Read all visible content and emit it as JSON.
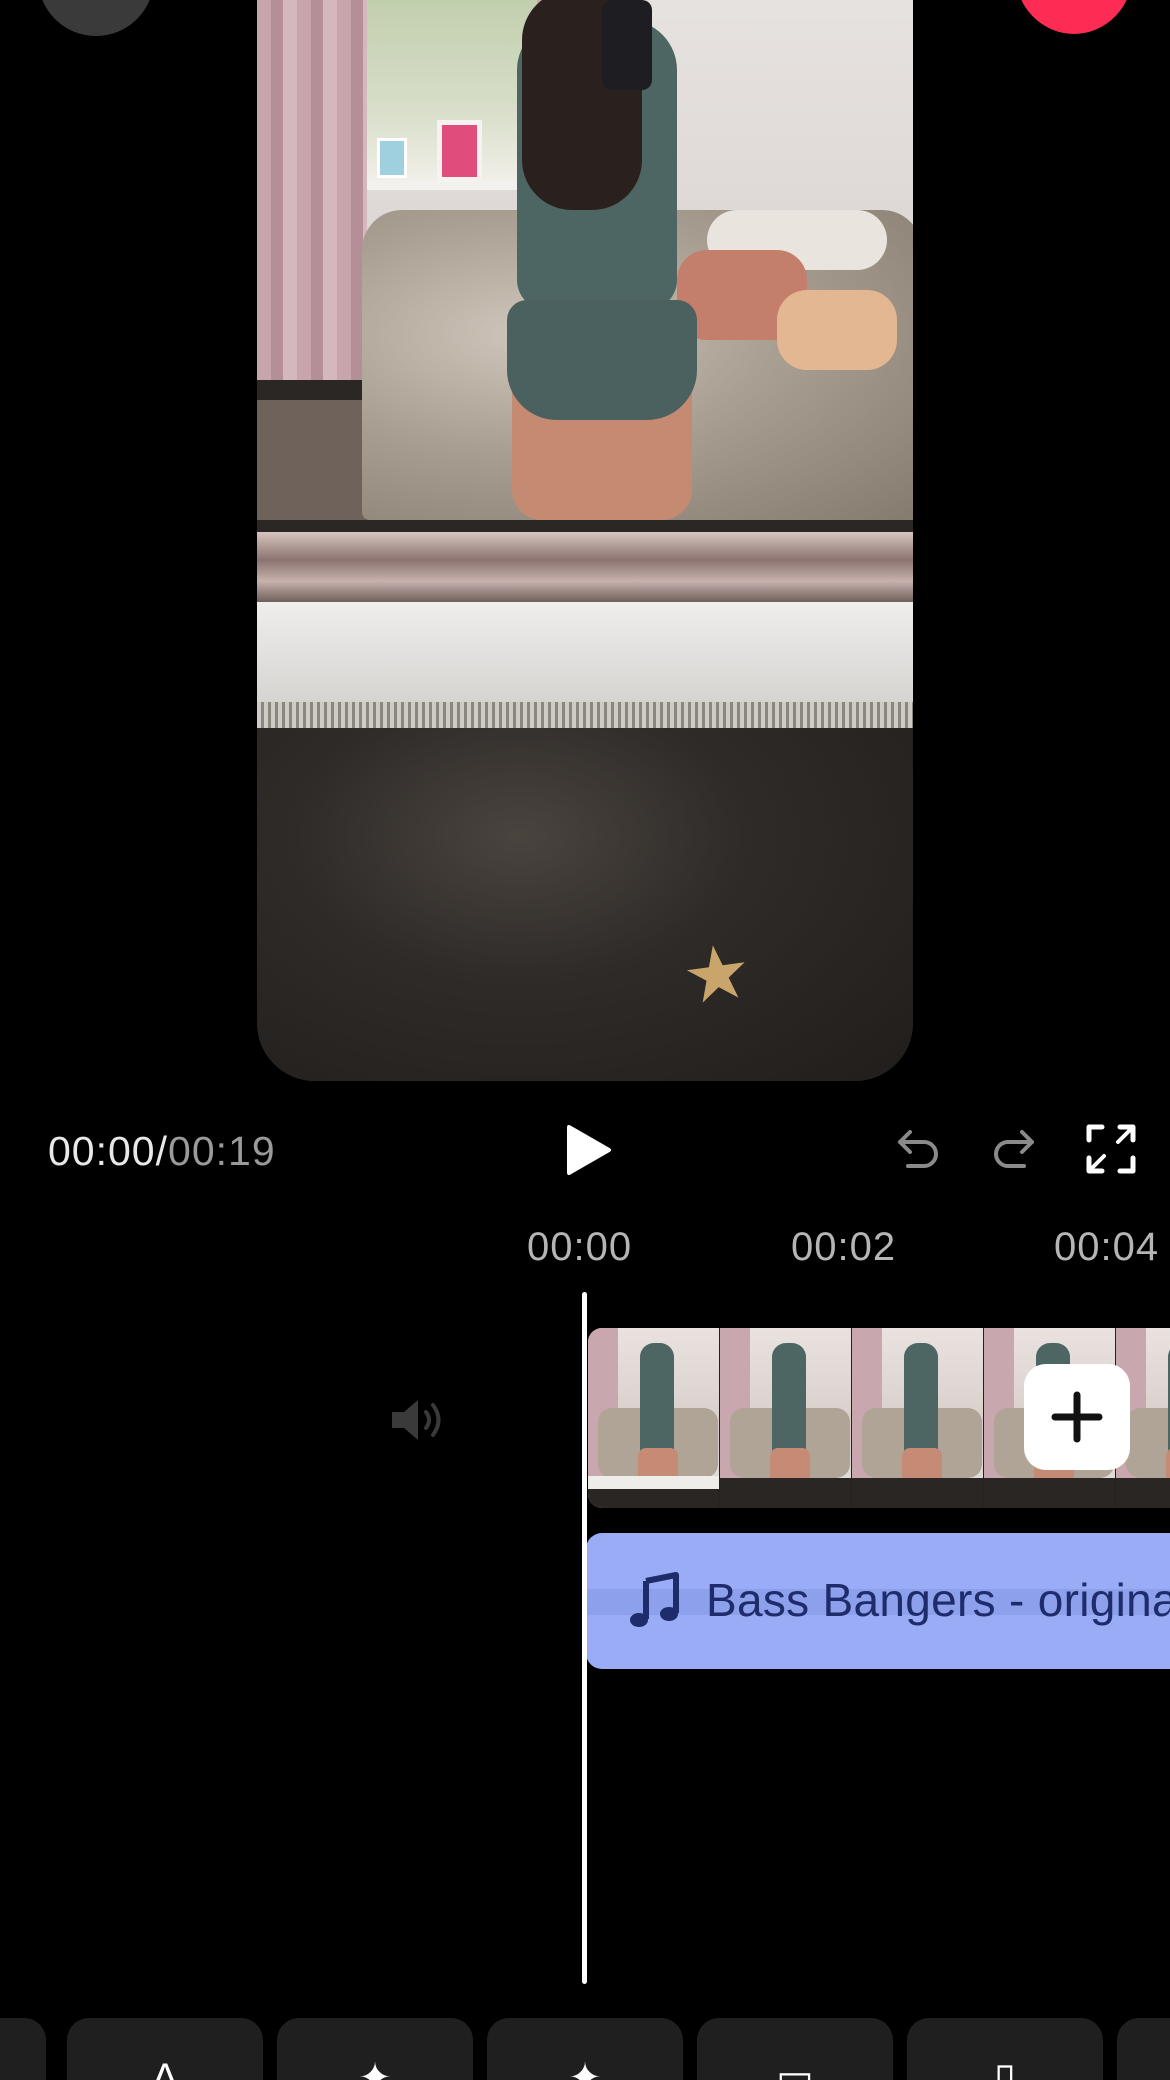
{
  "player": {
    "current_time": "00:00",
    "separator": "/",
    "total_time": "00:19"
  },
  "controls": {
    "play_icon": "play-icon",
    "undo_icon": "undo-icon",
    "redo_icon": "redo-icon",
    "fullscreen_icon": "fullscreen-icon"
  },
  "timeline": {
    "ticks": [
      "00:00",
      "00:02",
      "00:04"
    ],
    "mute_icon": "speaker-icon",
    "add_clip_icon": "plus-icon",
    "audio_track_label": "Bass Bangers - origina",
    "audio_icon": "music-note-icon"
  },
  "colors": {
    "record_accent": "#fe2c55",
    "audio_track": "#9aacf6",
    "audio_text": "#1f2c6b",
    "background": "#000000"
  },
  "toolbar": {
    "glyphs": [
      "",
      "A",
      "✦",
      "✦",
      "▭",
      "▯",
      ""
    ]
  }
}
